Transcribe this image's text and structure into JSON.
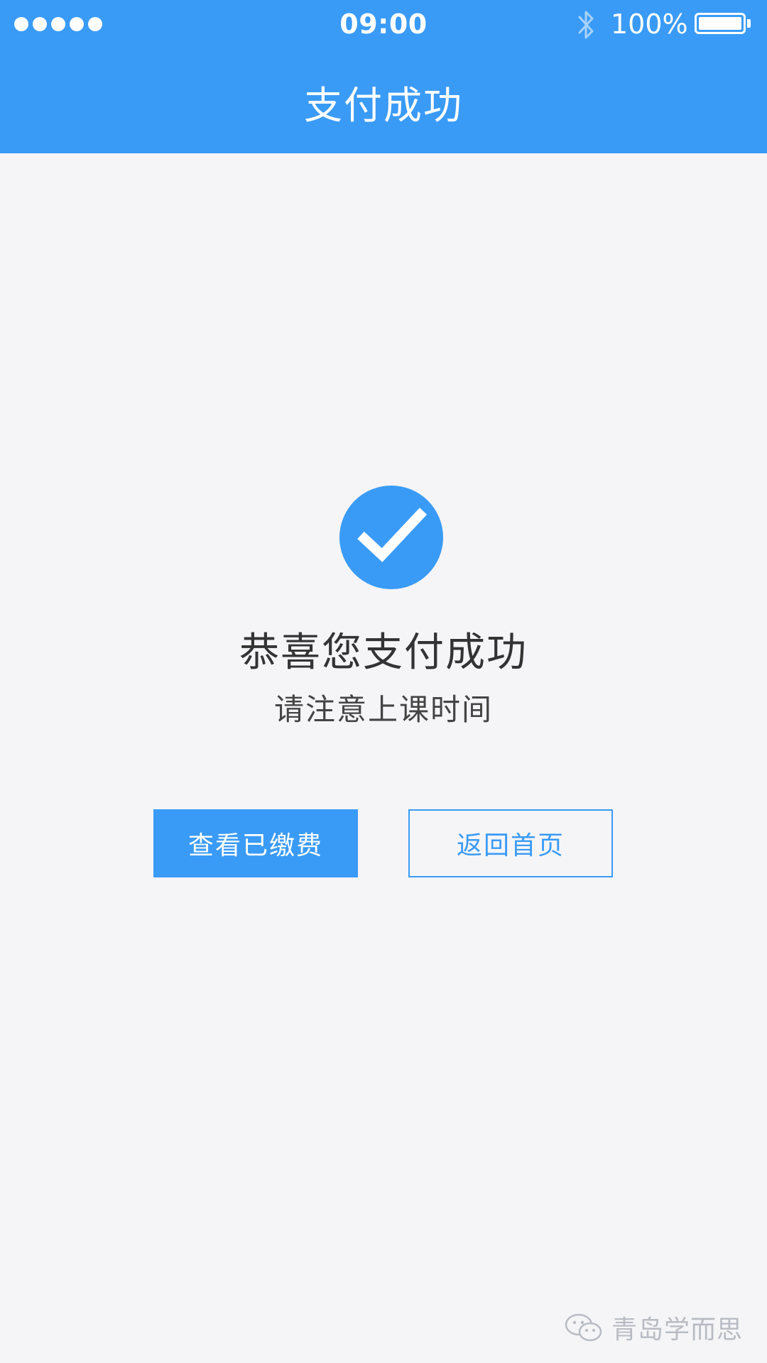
{
  "status_bar": {
    "signal_dots": 5,
    "time": "09:00",
    "battery_percent": "100%",
    "battery_level": 1.0,
    "bluetooth_icon": "bluetooth-icon"
  },
  "navbar": {
    "title": "支付成功"
  },
  "success": {
    "icon": "check-circle-icon",
    "headline": "恭喜您支付成功",
    "subline": "请注意上课时间"
  },
  "buttons": {
    "view_paid_label": "查看已缴费",
    "back_home_label": "返回首页"
  },
  "watermark": {
    "icon": "wechat-icon",
    "text": "青岛学而思"
  },
  "colors": {
    "accent": "#3a9bf6",
    "background": "#f5f5f8",
    "headline_text": "#333333",
    "watermark_text": "#b8bcc2"
  }
}
